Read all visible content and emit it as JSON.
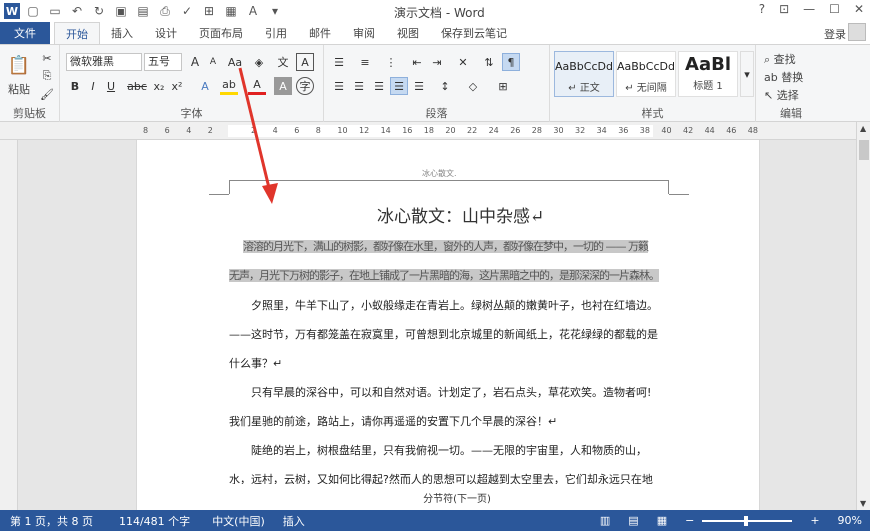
{
  "app": {
    "title": "演示文档 - Word",
    "help": "?",
    "minimize": "—",
    "maximize": "☐",
    "close": "✕"
  },
  "tabs": [
    "文件",
    "开始",
    "插入",
    "设计",
    "页面布局",
    "引用",
    "邮件",
    "审阅",
    "视图",
    "保存到云笔记"
  ],
  "account": {
    "login": "登录"
  },
  "ribbon": {
    "clipboard": {
      "paste": "粘贴",
      "label": "剪贴板"
    },
    "font": {
      "family": "微软雅黑",
      "size": "五号",
      "label": "字体",
      "bold": "B",
      "italic": "I",
      "underline": "U",
      "strike": "abc",
      "sub": "x₂",
      "sup": "x²",
      "grow": "A",
      "shrink": "A",
      "aa": "Aa",
      "charborder": "A",
      "charshade": "A",
      "textfx": "A",
      "hilite": "ab",
      "fontcolor": "A",
      "phonetic": "文",
      "enclose": "字"
    },
    "paragraph": {
      "label": "段落"
    },
    "styles": {
      "label": "样式",
      "items": [
        {
          "preview": "AaBbCcDd",
          "name": "↵ 正文"
        },
        {
          "preview": "AaBbCcDd",
          "name": "↵ 无间隔"
        },
        {
          "preview": "AaBl",
          "name": "标题 1"
        }
      ]
    },
    "editing": {
      "label": "编辑",
      "find": "查找",
      "replace": "替换",
      "select": "选择"
    }
  },
  "ruler": {
    "ticks": [
      "8",
      "6",
      "4",
      "2",
      "",
      "2",
      "4",
      "6",
      "8",
      "10",
      "12",
      "14",
      "16",
      "18",
      "20",
      "22",
      "24",
      "26",
      "28",
      "30",
      "32",
      "34",
      "36",
      "38",
      "40",
      "42",
      "44",
      "46",
      "48"
    ]
  },
  "document": {
    "header": "冰心散文.",
    "title": "冰心散文：山中杂感↵",
    "para1_line1": "溶溶的月光下，满山的树影，都好像在水里，窗外的人声，都好像在梦中，一切的 —— 万籁",
    "para1_line2": "无声，月光下万树的影子，在地上铺成了一片黑暗的海，这片黑暗之中的，是那深深的一片森林。↵",
    "para2": "夕照里，牛羊下山了，小蚁般缘走在青岩上。绿树丛颠的嫩黄叶子，也衬在红墙边。——这时节，万有都笼盖在寂寞里，可曾想到北京城里的新闻纸上，花花绿绿的都载的是什么事？↵",
    "para3": "只有早晨的深谷中，可以和自然对语。计划定了，岩石点头，草花欢笑。造物者呵!我们星驰的前途，路站上，请你再遥遥的安置下几个早晨的深谷！↵",
    "para4": "陡绝的岩上，树根盘结里，只有我俯视一切。——无限的宇宙里，人和物质的山，水，远村，云树，又如何比得起?然而人的思想可以超越到太空里去，它们却永远只在地面上。",
    "section_break": "分节符(下一页)"
  },
  "statusbar": {
    "page": "第 1 页，共 8 页",
    "words": "114/481 个字",
    "lang": "中文(中国)",
    "mode": "插入",
    "zoom_minus": "−",
    "zoom_plus": "+",
    "zoom": "90%"
  },
  "colors": {
    "accent": "#2b579a",
    "arrow": "#e0352b",
    "highlight": "#c8c8c8"
  }
}
